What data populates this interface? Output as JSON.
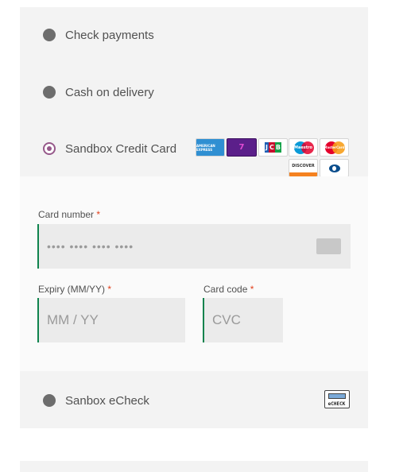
{
  "payment_methods": {
    "check": {
      "label": "Check payments",
      "selected": false
    },
    "cod": {
      "label": "Cash on delivery",
      "selected": false
    },
    "sandbox_cc": {
      "label": "Sandbox Credit Card",
      "selected": true
    },
    "echeck": {
      "label": "Sanbox eCheck",
      "selected": false
    }
  },
  "card_brands": [
    {
      "name": "amex-icon",
      "text": "AMERICAN EXPRESS"
    },
    {
      "name": "card-icon",
      "text": "7"
    },
    {
      "name": "jcb-icon",
      "text": "JCB"
    },
    {
      "name": "maestro-icon",
      "text": "Maestro"
    },
    {
      "name": "mastercard-icon",
      "text": "MasterCard"
    },
    {
      "name": "discover-icon",
      "text": "DISCOVER"
    },
    {
      "name": "diners-club-icon",
      "text": ""
    }
  ],
  "echeck_icon": {
    "name": "echeck-icon",
    "text": "eCHECK"
  },
  "cc_form": {
    "card_number": {
      "label": "Card number",
      "required_mark": "*",
      "placeholder": "•••• •••• •••• ••••"
    },
    "expiry": {
      "label": "Expiry (MM/YY)",
      "required_mark": "*",
      "placeholder": "MM / YY"
    },
    "card_code": {
      "label": "Card code",
      "required_mark": "*",
      "placeholder": "CVC"
    }
  },
  "colors": {
    "panel_bg": "#f3f3f3",
    "form_bg": "#fafafa",
    "radio_selected": "#96588a",
    "input_accent": "#0f834d",
    "required": "#e2401c"
  }
}
